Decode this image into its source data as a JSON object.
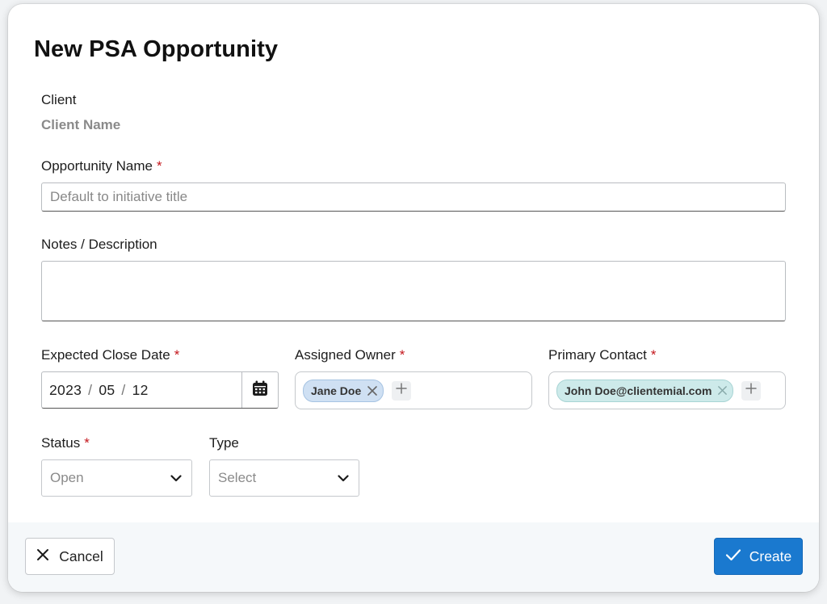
{
  "dialog": {
    "title": "New PSA Opportunity"
  },
  "client": {
    "label": "Client",
    "value": "Client Name"
  },
  "opportunity_name": {
    "label": "Opportunity Name",
    "required_mark": "*",
    "placeholder": "Default to initiative title"
  },
  "notes": {
    "label": "Notes / Description",
    "value": ""
  },
  "expected_close_date": {
    "label": "Expected Close Date",
    "required_mark": "*",
    "year": "2023",
    "month": "05",
    "day": "12",
    "separator": "/",
    "icon": "calendar-icon"
  },
  "assigned_owner": {
    "label": "Assigned Owner",
    "required_mark": "*",
    "chips": [
      "Jane Doe"
    ],
    "icon_add": "plus-icon",
    "icon_remove": "close-icon"
  },
  "primary_contact": {
    "label": "Primary Contact",
    "required_mark": "*",
    "chips": [
      "John Doe@clientemial.com"
    ],
    "icon_add": "plus-icon",
    "icon_remove": "close-icon"
  },
  "status": {
    "label": "Status",
    "required_mark": "*",
    "value": "Open",
    "icon": "chevron-down-icon"
  },
  "type": {
    "label": "Type",
    "value": "Select",
    "icon": "chevron-down-icon"
  },
  "footer": {
    "cancel_label": "Cancel",
    "create_label": "Create",
    "cancel_icon": "close-icon",
    "create_icon": "checkmark-icon"
  },
  "colors": {
    "accent": "#1a79cf",
    "required": "#c4161c",
    "chip_owner": "#cfe0f3",
    "chip_contact": "#cdeaea"
  }
}
